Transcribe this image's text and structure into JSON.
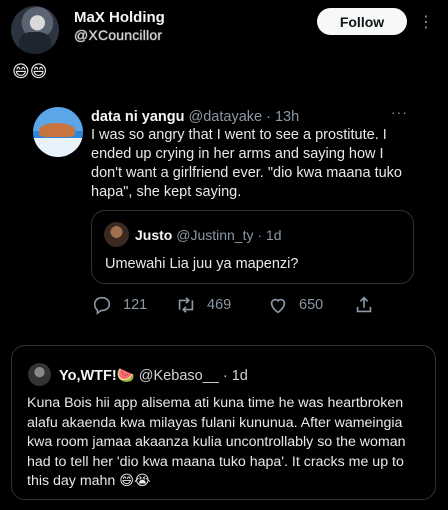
{
  "header": {
    "name": "MaX Holding",
    "handle": "@XCouncillor",
    "follow_label": "Follow",
    "more_label": "⋮",
    "emojis": "😄😄"
  },
  "tweet": {
    "author": "data ni yangu",
    "meta": " @datayake · 13h",
    "more_label": "···",
    "text": "I was so angry that I went to see a prostitute. I ended up crying in her arms and saying how I don't want a girlfriend ever. \"dio kwa maana tuko hapa\", she kept saying.",
    "quote": {
      "author": "Justo",
      "meta": " @Justinn_ty · 1d",
      "text": "Umewahi Lia juu ya mapenzi?"
    },
    "actions": {
      "replies": "121",
      "retweets": "469",
      "likes": "650"
    }
  },
  "card": {
    "author": "Yo,WTF!🍉",
    "meta": " @Kebaso__ · 1d",
    "text": "Kuna Bois hii app alisema ati kuna time he was heartbroken alafu akaenda kwa milayas fulani kununua. After wameingia kwa room jamaa akaanza kulia uncontrollably so the woman had to tell her 'dio kwa maana tuko hapa'. It cracks me up to this day mahn 😄😭"
  },
  "icons": {
    "reply": "reply-icon",
    "retweet": "retweet-icon",
    "like": "heart-icon",
    "share": "share-icon"
  }
}
